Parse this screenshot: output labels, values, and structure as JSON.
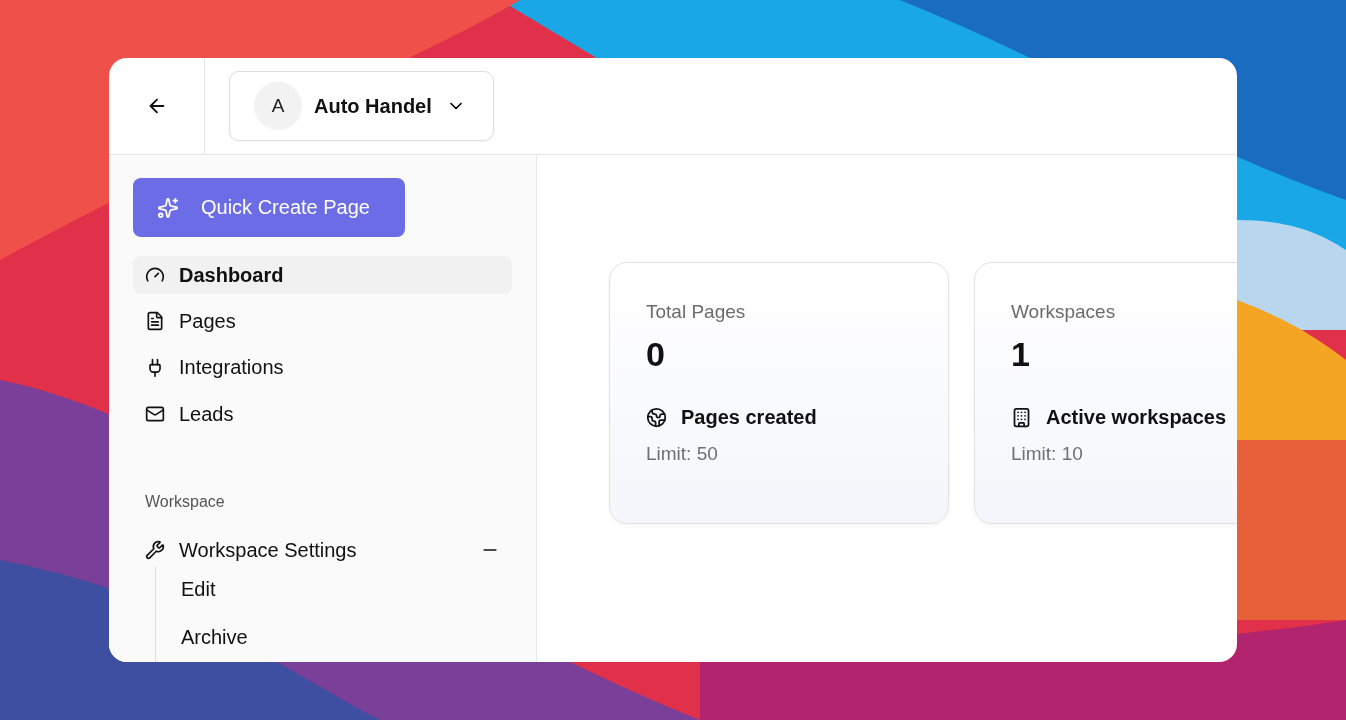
{
  "header": {
    "account": {
      "avatar": "A",
      "name": "Auto Handel"
    }
  },
  "sidebar": {
    "quick_create": "Quick Create Page",
    "items": [
      {
        "label": "Dashboard",
        "selected": true
      },
      {
        "label": "Pages",
        "selected": false
      },
      {
        "label": "Integrations",
        "selected": false
      },
      {
        "label": "Leads",
        "selected": false
      }
    ],
    "sections": [
      {
        "title": "Workspace",
        "items": [
          {
            "label": "Workspace Settings",
            "expanded": true,
            "children": [
              {
                "label": "Edit"
              },
              {
                "label": "Archive"
              }
            ]
          }
        ]
      }
    ]
  },
  "stats": [
    {
      "title": "Total Pages",
      "value": "0",
      "caption": "Pages created",
      "limit": "Limit: 50"
    },
    {
      "title": "Workspaces",
      "value": "1",
      "caption": "Active workspaces",
      "limit": "Limit: 10"
    }
  ]
}
